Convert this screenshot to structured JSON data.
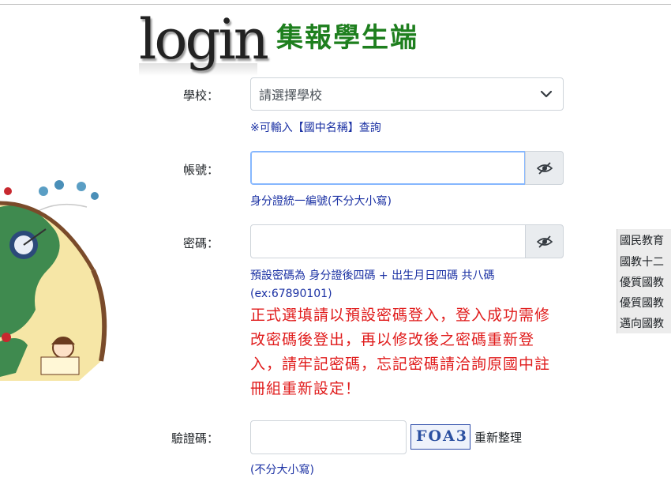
{
  "header": {
    "logo_text": "login",
    "title": "集報學生端"
  },
  "school": {
    "label": "學校：",
    "selected": "請選擇學校",
    "hint": "※可輸入【國中名稱】查詢"
  },
  "account": {
    "label": "帳號：",
    "value": "",
    "hint": "身分證統一編號(不分大小寫)"
  },
  "password": {
    "label": "密碼：",
    "value": "",
    "hint_line1": "預設密碼為 身分證後四碼 + 出生月日四碼 共八碼",
    "hint_line2": "(ex:67890101)",
    "warning": "正式選填請以預設密碼登入，登入成功需修改密碼後登出，再以修改後之密碼重新登入，請牢記密碼，忘記密碼請洽詢原國中註冊組重新設定！"
  },
  "captcha": {
    "label": "驗證碼：",
    "value": "",
    "image_text": "FOA3",
    "refresh_label": "重新整理",
    "hint": "(不分大小寫)"
  },
  "news": {
    "items": [
      "國民教育",
      "國教十二",
      "優質國教",
      "優質國教",
      "邁向國教"
    ]
  },
  "colors": {
    "title_green": "#1e7f1e",
    "hint_blue": "#1a30a3",
    "warning_red": "#e01b1b",
    "focus_border": "#86b7fe"
  },
  "icons": {
    "select_arrow": "chevron-down-icon",
    "password_toggle": "eye-slash-icon"
  }
}
